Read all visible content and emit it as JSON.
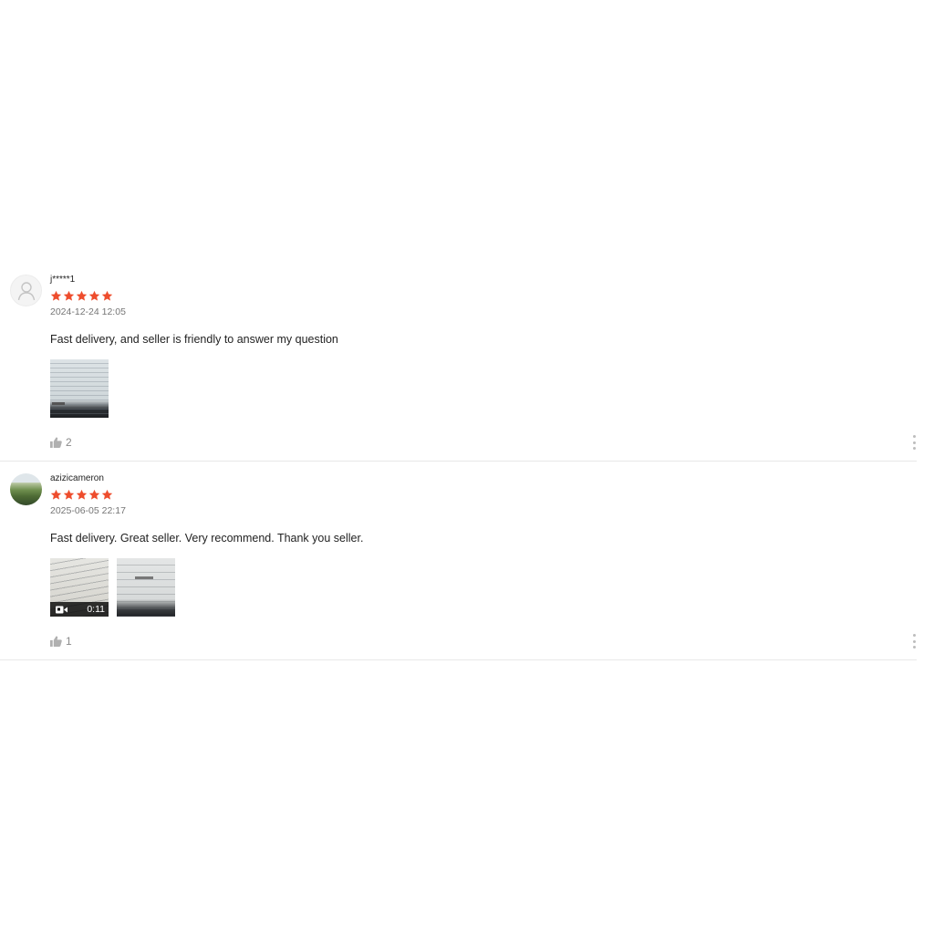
{
  "reviews": [
    {
      "username": "j*****1",
      "rating": 5,
      "date": "2024-12-24 12:05",
      "text": "Fast delivery, and seller is friendly to answer my question",
      "avatar": "default-user-icon",
      "likes": "2"
    },
    {
      "username": "azizicameron",
      "rating": 5,
      "date": "2025-06-05 22:17",
      "text": "Fast delivery. Great seller. Very recommend. Thank you seller.",
      "avatar": "user-photo",
      "video_duration": "0:11",
      "likes": "1"
    }
  ],
  "colors": {
    "star": "#ee4d2d",
    "divider": "#e8e8e8",
    "muted_text": "#757575"
  },
  "icons": [
    "user-icon",
    "star-icon",
    "thumbs-up-icon",
    "video-camera-icon",
    "more-vertical-icon"
  ]
}
